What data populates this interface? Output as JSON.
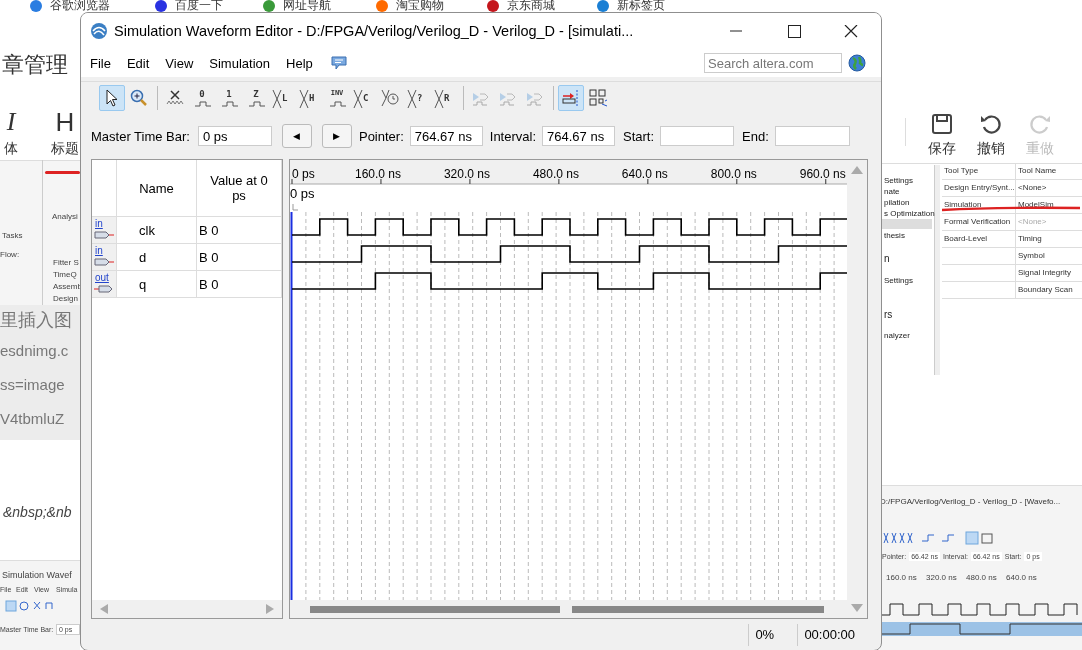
{
  "background": {
    "bookmarks": [
      "谷歌浏览器",
      "百度一下",
      "网址导航",
      "淘宝购物",
      "京东商城",
      "新标签页"
    ],
    "editor_title": "章管理",
    "format_buttons": [
      {
        "glyph": "I",
        "label": "体"
      },
      {
        "glyph": "H",
        "label": "标题"
      }
    ],
    "actions": [
      {
        "label": "保存",
        "kind": "save",
        "disabled": false
      },
      {
        "label": "撤销",
        "kind": "undo",
        "disabled": false
      },
      {
        "label": "重做",
        "kind": "redo",
        "disabled": true
      }
    ],
    "left_panel": {
      "tabs": [
        "Tasks"
      ],
      "flow_label": "Flow:",
      "tree": [
        "Analysi",
        "Fitter S",
        "TimeQ",
        "Assemb",
        "Design"
      ]
    },
    "pasted_lines": [
      "里插入图",
      "esdnimg.c",
      "ss=image",
      "V4tbmluZ"
    ],
    "code_fragment": "&nbsp;&nb",
    "thumbnail_left": {
      "title": "Simulation Wavef",
      "menu": [
        "File",
        "Edit",
        "View",
        "Simula"
      ],
      "master_label": "Master Time Bar:",
      "master_value": "0 ps"
    },
    "settings_list": [
      "Settings",
      "nate",
      "pilation",
      "s Optimization",
      "thesis",
      "n",
      "Settings",
      "rs",
      "nalyzer"
    ],
    "tool_table": {
      "columns": [
        "Tool Type",
        "Tool Name"
      ],
      "rows": [
        {
          "tool_type": "Design Entry/Synt...",
          "tool_name": "<None>",
          "disabled": false
        },
        {
          "tool_type": "Simulation",
          "tool_name": "ModelSim",
          "disabled": false
        },
        {
          "tool_type": "Formal Verification",
          "tool_name": "<None>",
          "disabled": true
        },
        {
          "tool_type": "Board-Level",
          "tool_name": "Timing",
          "disabled": false
        },
        {
          "tool_name": "Symbol",
          "disabled": false
        },
        {
          "tool_name": "Signal Integrity",
          "disabled": false
        },
        {
          "tool_name": "Boundary Scan",
          "disabled": false
        }
      ]
    },
    "thumbnail_right": {
      "title": "D:/FPGA/Verilog/Verilog_D - Verilog_D - [Wavefo...",
      "fields": [
        {
          "label": "Pointer:",
          "value": "66.42 ns"
        },
        {
          "label": "Interval:",
          "value": "66.42 ns"
        },
        {
          "label": "Start:",
          "value": "0 ps"
        }
      ],
      "ticks": [
        "160.0 ns",
        "320.0 ns",
        "480.0 ns",
        "640.0 ns"
      ]
    }
  },
  "window": {
    "title": "Simulation Waveform Editor - D:/FPGA/Verilog/Verilog_D - Verilog_D - [simulati...",
    "menu": [
      "File",
      "Edit",
      "View",
      "Simulation",
      "Help"
    ],
    "search": {
      "placeholder": "Search altera.com"
    },
    "toolbar": [
      [
        {
          "kind": "pointer",
          "selected": true,
          "disabled": false
        },
        {
          "kind": "zoom",
          "selected": false,
          "disabled": false
        }
      ],
      [
        {
          "kind": "unknown",
          "selected": false,
          "disabled": false
        },
        {
          "kind": "level",
          "glyph": "0",
          "selected": false,
          "disabled": false
        },
        {
          "kind": "level",
          "glyph": "1",
          "selected": false,
          "disabled": false
        },
        {
          "kind": "level",
          "glyph": "Z",
          "selected": false,
          "disabled": false
        },
        {
          "kind": "transition",
          "glyph": "L",
          "selected": false,
          "disabled": false
        },
        {
          "kind": "transition",
          "glyph": "H",
          "selected": false,
          "disabled": false
        },
        {
          "kind": "level",
          "glyph": "INV",
          "selected": false,
          "disabled": false
        },
        {
          "kind": "transition",
          "glyph": "C",
          "selected": false,
          "disabled": false
        },
        {
          "kind": "timer",
          "selected": false,
          "disabled": false
        },
        {
          "kind": "transition",
          "glyph": "?",
          "selected": false,
          "disabled": false
        },
        {
          "kind": "transition",
          "glyph": "R",
          "selected": false,
          "disabled": false
        }
      ],
      [
        {
          "kind": "run",
          "selected": false,
          "disabled": true
        },
        {
          "kind": "run",
          "selected": false,
          "disabled": true
        },
        {
          "kind": "run",
          "selected": false,
          "disabled": true
        }
      ],
      [
        {
          "kind": "snap",
          "selected": true,
          "disabled": false
        },
        {
          "kind": "grid",
          "selected": false,
          "disabled": false
        }
      ]
    ],
    "time_bar": {
      "master_label": "Master Time Bar:",
      "master_value": "0 ps",
      "prev": "◀",
      "next": "▶",
      "fields": [
        {
          "label": "Pointer:",
          "value": "764.67 ns"
        },
        {
          "label": "Interval:",
          "value": "764.67 ns"
        },
        {
          "label": "Start:"
        },
        {
          "label": "End:"
        }
      ]
    },
    "node_table": {
      "columns": [
        "Name",
        "Value at 0 ps"
      ],
      "rows": [
        {
          "kind": "input",
          "pin": "in",
          "name": "clk",
          "value": "B 0"
        },
        {
          "kind": "input",
          "pin": "in",
          "name": "d",
          "value": "B 0"
        },
        {
          "kind": "output",
          "pin": "out",
          "name": "q",
          "value": "B 0"
        }
      ]
    },
    "marker_label": "0 ps",
    "time_ruler": [
      "0 ps",
      "160.0 ns",
      "320.0 ns",
      "480.0 ns",
      "640.0 ns",
      "800.0 ns",
      "960.0 ns"
    ],
    "status": {
      "progress": "0%",
      "elapsed": "00:00:00"
    }
  }
}
